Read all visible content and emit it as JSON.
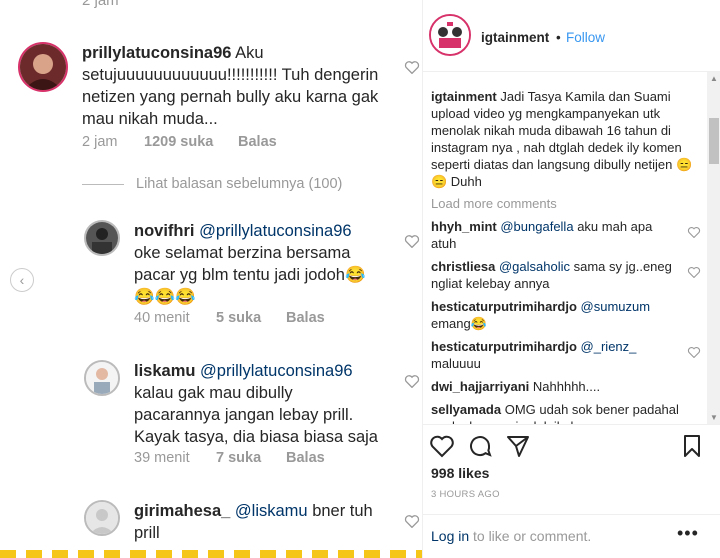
{
  "left": {
    "cut_time": "2 jam",
    "view_previous": "Lihat balasan sebelumnya (100)",
    "comments": [
      {
        "username": "prillylatuconsina96",
        "mention": "",
        "text_lines": [
          "prillylatuconsina96 Aku",
          "setujuuuuuuuuuuuu!!!!!!!!!!! Tuh dengerin",
          "netizen yang pernah bully aku karna gak",
          "mau nikah muda..."
        ],
        "time": "2 jam",
        "likes": "1209 suka",
        "reply": "Balas"
      },
      {
        "username": "novifhri",
        "mention": "@prillylatuconsina96",
        "text_lines": [
          "oke selamat berzina bersama",
          "pacar yg blm tentu jadi jodoh😂",
          "😂😂😂"
        ],
        "time": "40 menit",
        "likes": "5 suka",
        "reply": "Balas"
      },
      {
        "username": "liskamu",
        "mention": "@prillylatuconsina96",
        "text_lines": [
          "kalau gak mau dibully",
          "pacarannya jangan lebay prill.",
          "Kayak tasya, dia biasa biasa saja"
        ],
        "time": "39 menit",
        "likes": "7 suka",
        "reply": "Balas"
      },
      {
        "username": "girimahesa_",
        "mention": "@liskamu",
        "text_lines": [
          "bner tuh",
          "prill"
        ],
        "time": "",
        "likes": "",
        "reply": ""
      }
    ]
  },
  "post": {
    "account": "igtainment",
    "dot": "•",
    "follow": "Follow",
    "caption_user": "igtainment",
    "caption_text": "Jadi Tasya Kamila dan Suami upload video yg mengkampanyekan utk menolak nikah muda dibawah 16 tahun di instagram nya , nah dtglah dedek ily komen seperti diatas dan langsung dibully netijen 😑😑 Duhh",
    "load_more": "Load more comments",
    "comments": [
      {
        "user": "hhyh_mint",
        "mention": "@bungafella",
        "text": "aku mah apa atuh"
      },
      {
        "user": "christliesa",
        "mention": "@galsaholic",
        "text": "sama sy jg..eneg ngliat kelebay annya"
      },
      {
        "user": "hesticaturputrimihardjo",
        "mention": "@sumuzum",
        "text": "emang😂"
      },
      {
        "user": "hesticaturputrimihardjo",
        "mention": "@_rienz_",
        "text": "maluuuu"
      },
      {
        "user": "dwi_hajjarriyani",
        "mention": "",
        "text": "Nahhhhh...."
      },
      {
        "user": "sellyamada",
        "mention": "",
        "text": "OMG udah sok bener padahal zonk , hapus aja dek ilu komen"
      }
    ],
    "likes": "998 likes",
    "time": "3 HOURS AGO",
    "login": "Log in",
    "login_rest": "to like or comment.",
    "more_dots": "•••"
  },
  "icons": {
    "heart": "heart-icon",
    "comment": "comment-icon",
    "share": "share-icon",
    "bookmark": "bookmark-icon",
    "prev": "chevron-left-icon"
  },
  "colors": {
    "link": "#3897f0",
    "mention": "#003569",
    "muted": "#999999"
  }
}
